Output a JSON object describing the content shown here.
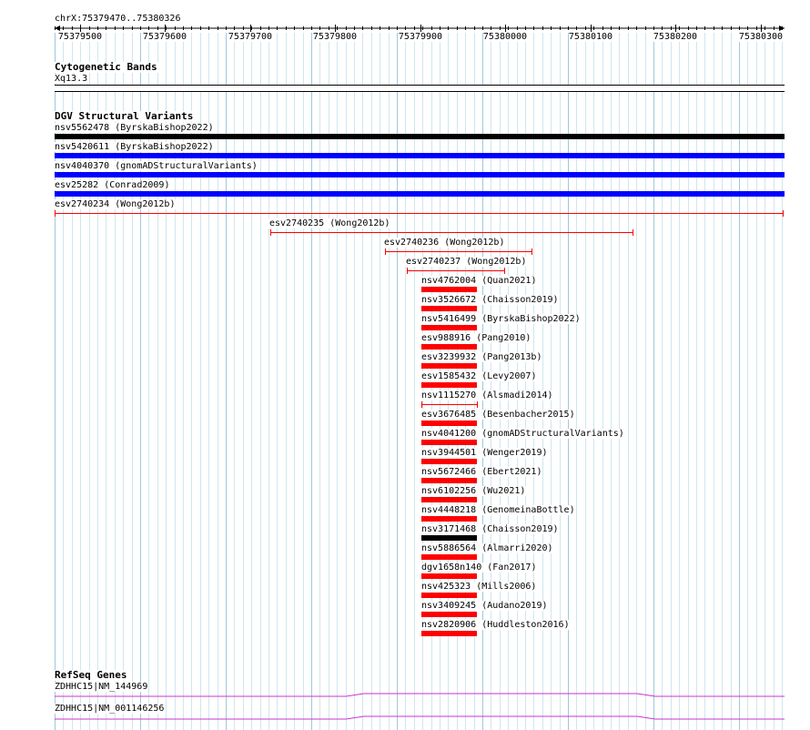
{
  "locus": {
    "label": "chrX:75379470..75380326",
    "ticks": [
      "75379500",
      "75379600",
      "75379700",
      "75379800",
      "75379900",
      "75380000",
      "75380100",
      "75380200",
      "75380300"
    ]
  },
  "cytoband": {
    "title": "Cytogenetic Bands",
    "band": "Xq13.3"
  },
  "dgv": {
    "title": "DGV Structural Variants",
    "colors": {
      "loss": "#ff0000",
      "gain": "#0000ff",
      "both": "#000000"
    },
    "features": [
      {
        "id": "nsv5562478",
        "study": "ByrskaBishop2022",
        "color": "#000000",
        "style": "block"
      },
      {
        "id": "nsv5420611",
        "study": "ByrskaBishop2022",
        "color": "#0000ff",
        "style": "block"
      },
      {
        "id": "nsv4040370",
        "study": "gnomADStructuralVariants",
        "color": "#0000ff",
        "style": "block"
      },
      {
        "id": "esv25282",
        "study": "Conrad2009",
        "color": "#0000ff",
        "style": "block"
      },
      {
        "id": "esv2740234",
        "study": "Wong2012b",
        "color": "#ff0000",
        "style": "line"
      },
      {
        "id": "esv2740235",
        "study": "Wong2012b",
        "color": "#ff0000",
        "style": "line"
      },
      {
        "id": "esv2740236",
        "study": "Wong2012b",
        "color": "#ff0000",
        "style": "line"
      },
      {
        "id": "esv2740237",
        "study": "Wong2012b",
        "color": "#ff0000",
        "style": "line"
      },
      {
        "id": "nsv4762004",
        "study": "Quan2021",
        "color": "#ff0000",
        "style": "block"
      },
      {
        "id": "nsv3526672",
        "study": "Chaisson2019",
        "color": "#ff0000",
        "style": "block"
      },
      {
        "id": "nsv5416499",
        "study": "ByrskaBishop2022",
        "color": "#ff0000",
        "style": "block"
      },
      {
        "id": "esv988916",
        "study": "Pang2010",
        "color": "#ff0000",
        "style": "block"
      },
      {
        "id": "esv3239932",
        "study": "Pang2013b",
        "color": "#ff0000",
        "style": "block"
      },
      {
        "id": "esv1585432",
        "study": "Levy2007",
        "color": "#ff0000",
        "style": "block"
      },
      {
        "id": "nsv1115270",
        "study": "Alsmadi2014",
        "color": "#ff0000",
        "style": "line"
      },
      {
        "id": "esv3676485",
        "study": "Besenbacher2015",
        "color": "#ff0000",
        "style": "block"
      },
      {
        "id": "nsv4041200",
        "study": "gnomADStructuralVariants",
        "color": "#ff0000",
        "style": "block"
      },
      {
        "id": "nsv3944501",
        "study": "Wenger2019",
        "color": "#ff0000",
        "style": "block"
      },
      {
        "id": "nsv5672466",
        "study": "Ebert2021",
        "color": "#ff0000",
        "style": "block"
      },
      {
        "id": "nsv6102256",
        "study": "Wu2021",
        "color": "#ff0000",
        "style": "block"
      },
      {
        "id": "nsv4448218",
        "study": "GenomeinaBottle",
        "color": "#ff0000",
        "style": "block"
      },
      {
        "id": "nsv3171468",
        "study": "Chaisson2019",
        "color": "#000000",
        "style": "block"
      },
      {
        "id": "nsv5886564",
        "study": "Almarri2020",
        "color": "#ff0000",
        "style": "block"
      },
      {
        "id": "dgv1658n140",
        "study": "Fan2017",
        "color": "#ff0000",
        "style": "block"
      },
      {
        "id": "nsv425323",
        "study": "Mills2006",
        "color": "#ff0000",
        "style": "block"
      },
      {
        "id": "nsv3409245",
        "study": "Audano2019",
        "color": "#ff0000",
        "style": "block"
      },
      {
        "id": "nsv2820906",
        "study": "Huddleston2016",
        "color": "#ff0000",
        "style": "block"
      }
    ]
  },
  "refseq": {
    "title": "RefSeq Genes",
    "color": "#cc33cc",
    "genes": [
      {
        "label": "ZDHHC15|NM_144969"
      },
      {
        "label": "ZDHHC15|NM_001146256"
      }
    ]
  }
}
